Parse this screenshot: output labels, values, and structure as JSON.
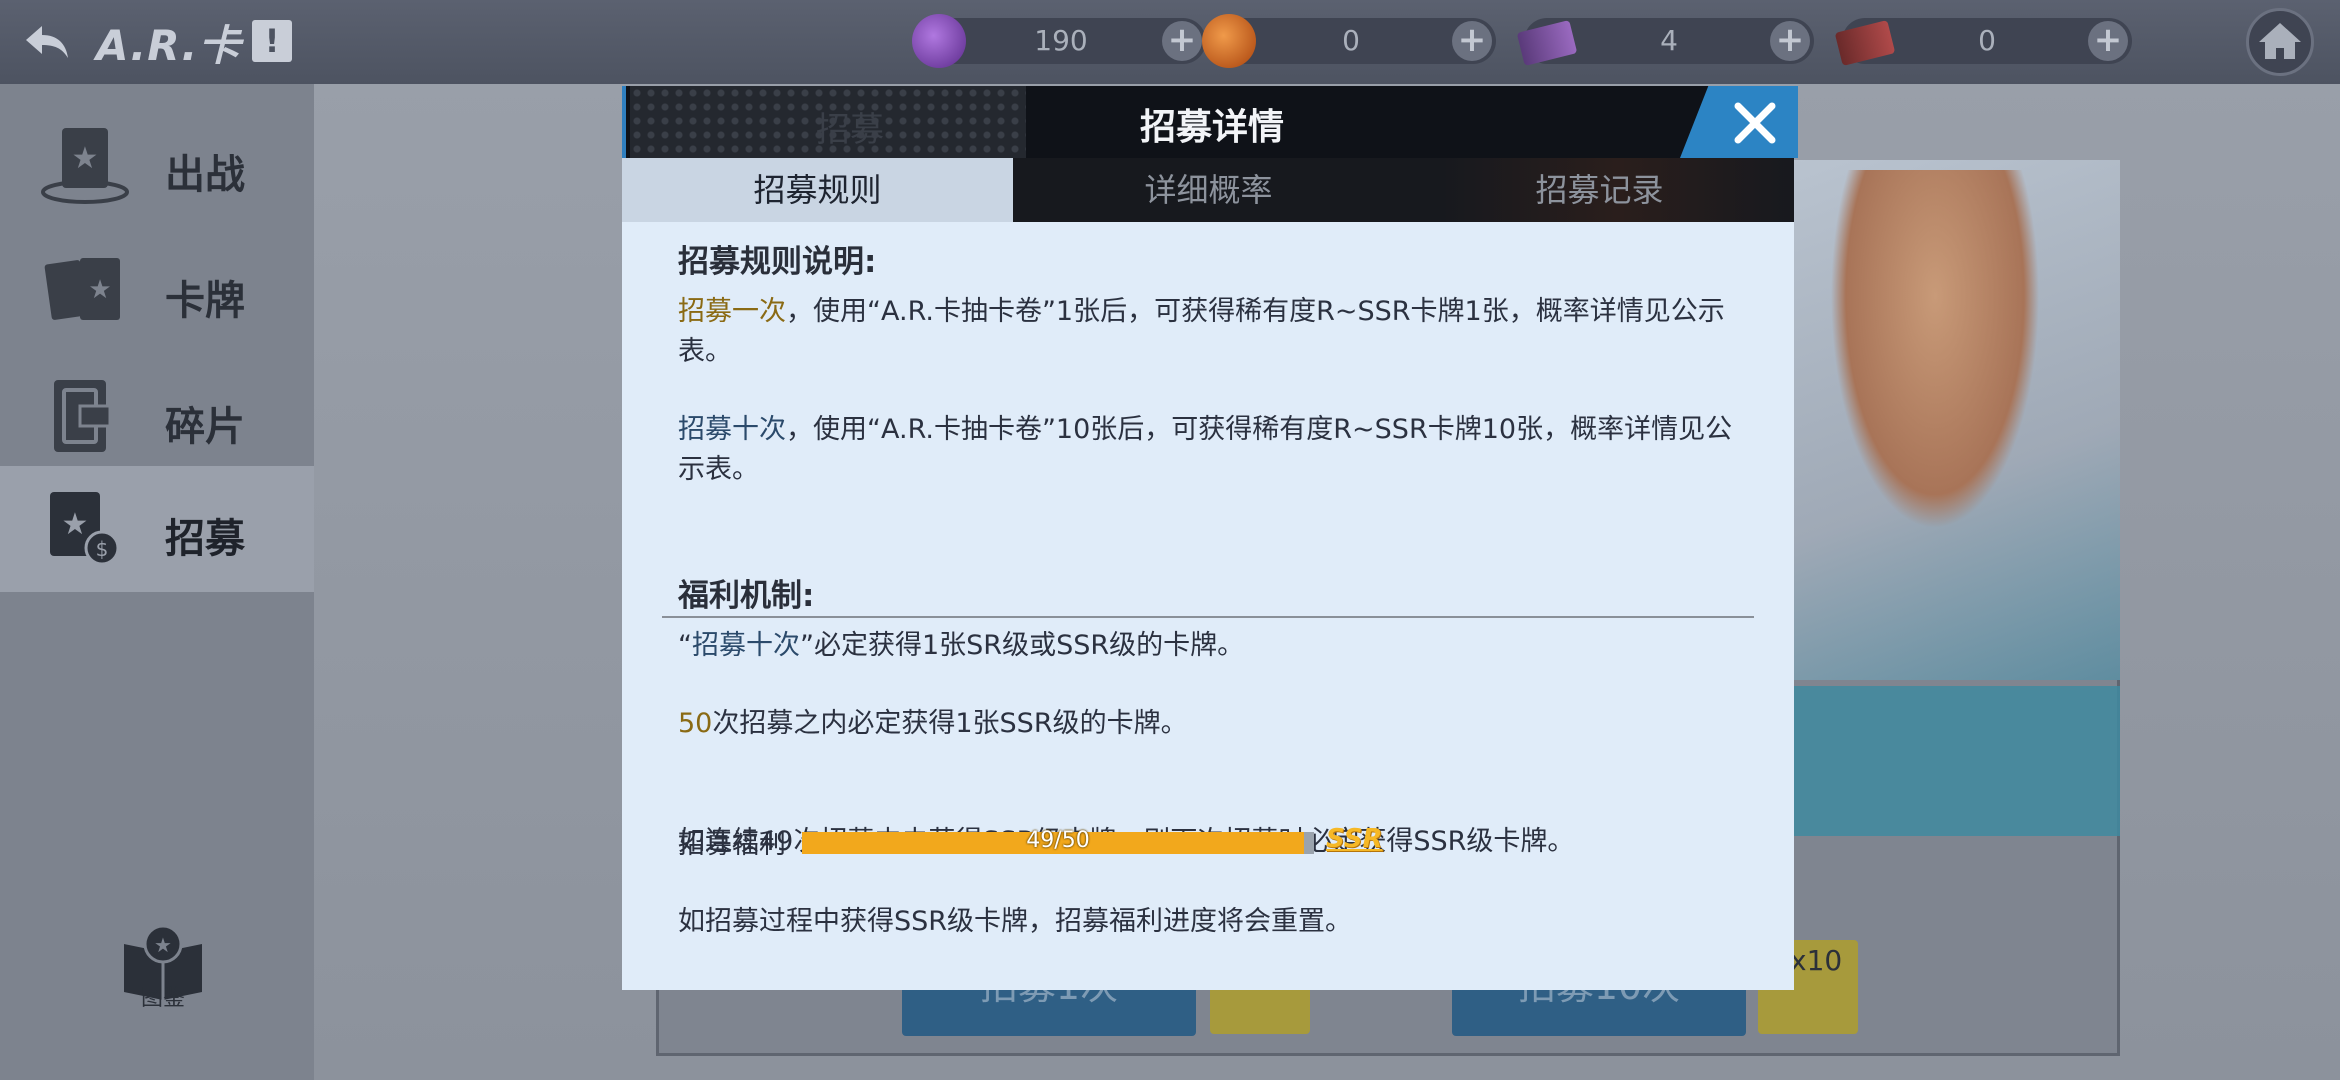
{
  "topbar": {
    "title": "A.R.卡",
    "info_glyph": "!",
    "currencies": [
      {
        "icon": "purple-crystal-icon",
        "value": "190",
        "color": "#8a4fc0"
      },
      {
        "icon": "orange-crystal-icon",
        "value": "0",
        "color": "#d8681c"
      },
      {
        "icon": "purple-ticket-icon",
        "value": "4",
        "color": "#7a4a9a"
      },
      {
        "icon": "red-ticket-icon",
        "value": "0",
        "color": "#9a3a3a"
      }
    ],
    "plus_glyph": "+"
  },
  "sidebar": {
    "items": [
      {
        "label": "出战",
        "icon": "deploy-card-icon",
        "active": false
      },
      {
        "label": "卡牌",
        "icon": "cards-icon",
        "active": false
      },
      {
        "label": "碎片",
        "icon": "fragment-icon",
        "active": false
      },
      {
        "label": "招募",
        "icon": "recruit-card-icon",
        "active": true
      }
    ],
    "codex_label": "图鉴"
  },
  "background": {
    "header_ghost": "招募",
    "btn_single": "招募1次",
    "btn_ten": "招募10次",
    "ticket_count": "x10"
  },
  "modal": {
    "title": "招募详情",
    "tabs": [
      {
        "label": "招募规则",
        "active": true
      },
      {
        "label": "详细概率",
        "active": false
      },
      {
        "label": "招募记录",
        "active": false
      }
    ],
    "rules_heading": "招募规则说明:",
    "rule1_highlight": "招募一次",
    "rule1_text": "，使用“A.R.卡抽卡卷”1张后，可获得稀有度R~SSR卡牌1张，概率详情见公示表。",
    "rule2_highlight": "招募十次",
    "rule2_text": "，使用“A.R.卡抽卡卷”10张后，可获得稀有度R~SSR卡牌10张，概率详情见公示表。",
    "welfare_heading": "福利机制:",
    "welfare1_prefix": "“",
    "welfare1_highlight": "招募十次",
    "welfare1_text": "”必定获得1张SR级或SSR级的卡牌。",
    "welfare2_highlight": "50",
    "welfare2_text": "次招募之内必定获得1张SSR级的卡牌。",
    "progress_label": "招募福利",
    "progress_text": "49/50",
    "progress_value": 49,
    "progress_max": 50,
    "progress_badge": "SSR",
    "welfare3_text": "如连续49次招募内未获得SSR级卡牌，则下次招募时必定获得SSR级卡牌。",
    "welfare4_text": "如招募过程中获得SSR级卡牌，招募福利进度将会重置。"
  },
  "colors": {
    "accent_blue": "#2c84c4",
    "progress_orange": "#f2a81c",
    "highlight_gold": "#8a6a14",
    "highlight_blue": "#2b4a6b"
  }
}
